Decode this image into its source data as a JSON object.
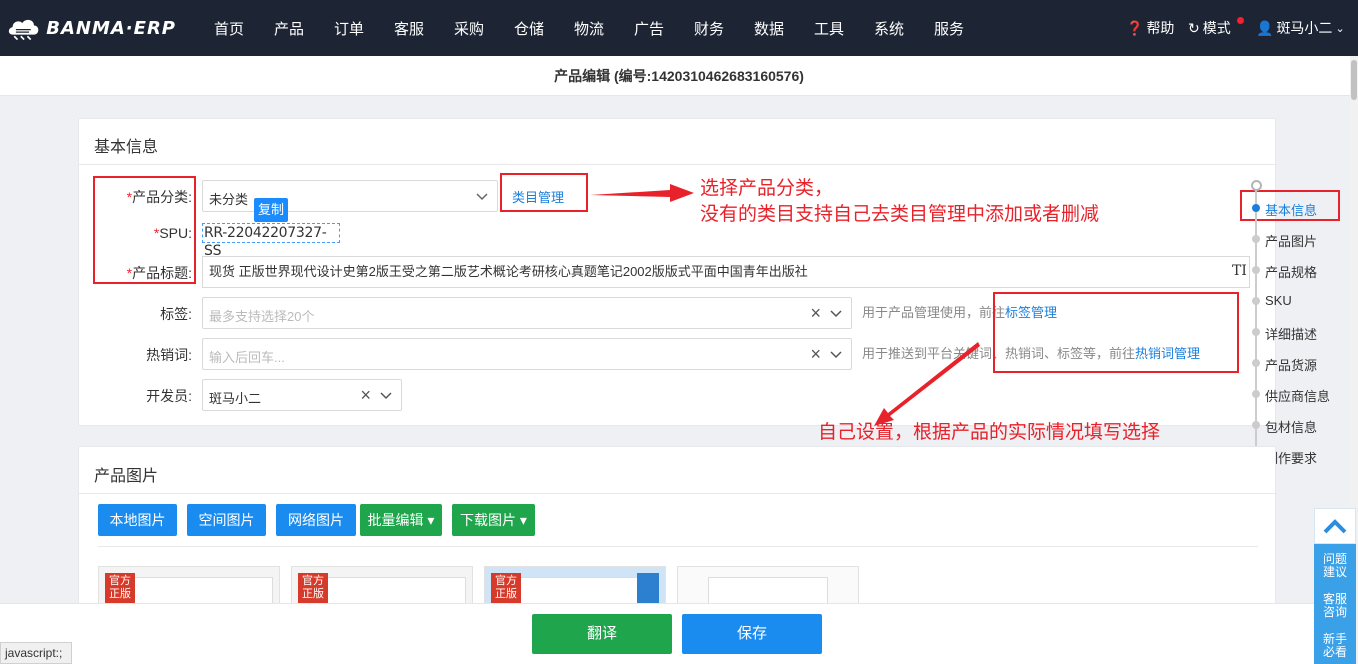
{
  "brand": {
    "name": "BANMA·ERP"
  },
  "nav": {
    "items": [
      "首页",
      "产品",
      "订单",
      "客服",
      "采购",
      "仓储",
      "物流",
      "广告",
      "财务",
      "数据",
      "工具",
      "系统",
      "服务"
    ],
    "help": "帮助",
    "mode": "模式",
    "user": "斑马小二"
  },
  "page_title": "产品编辑 (编号:1420310462683160576)",
  "basic": {
    "title": "基本信息",
    "category_label": "产品分类:",
    "category_value": "未分类",
    "category_manage": "类目管理",
    "copy_badge": "复制",
    "spu_label": "SPU:",
    "spu_value": "RR-22042207327-SS",
    "title_label": "产品标题:",
    "title_value": "现货 正版世界现代设计史第2版王受之第二版艺术概论考研核心真题笔记2002版版式平面中国青年出版社",
    "title_suffix": "TI",
    "tags_label": "标签:",
    "tags_placeholder": "最多支持选择20个",
    "tags_hint": "用于产品管理使用，前往",
    "tags_link": "标签管理",
    "hotwords_label": "热销词:",
    "hotwords_placeholder": "输入后回车...",
    "hotwords_hint": "用于推送到平台关键词、热销词、标签等，前往",
    "hotwords_link": "热销词管理",
    "developer_label": "开发员:",
    "developer_value": "斑马小二"
  },
  "annotations": {
    "line1": "选择产品分类，",
    "line2": "没有的类目支持自己去类目管理中添加或者删减",
    "line3": "自己设置，根据产品的实际情况填写选择"
  },
  "anchors": [
    "基本信息",
    "产品图片",
    "产品规格",
    "SKU",
    "详细描述",
    "产品货源",
    "供应商信息",
    "包材信息",
    "制作要求"
  ],
  "images": {
    "title": "产品图片",
    "buttons": [
      "本地图片",
      "空间图片",
      "网络图片",
      "批量编辑 ▾",
      "下载图片 ▾"
    ],
    "badge": "官方正版"
  },
  "footer": {
    "translate": "翻译",
    "save": "保存"
  },
  "status_text": "javascript:;",
  "float_panel": {
    "items": [
      "问题建议",
      "客服咨询",
      "新手必看"
    ]
  },
  "colors": {
    "primary": "#1a7fdc",
    "green": "#1fa54b",
    "annotation": "#e8222a",
    "nav_bg": "#1d2534"
  }
}
